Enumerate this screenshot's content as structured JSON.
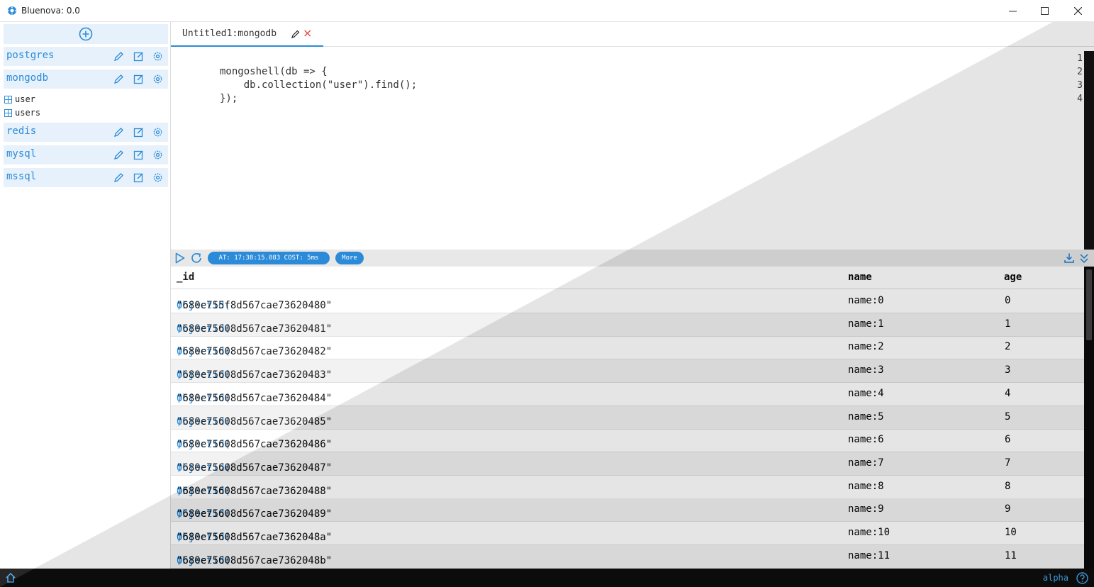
{
  "window": {
    "title": "Bluenova: 0.0"
  },
  "sidebar": {
    "connections": [
      {
        "name": "postgres"
      },
      {
        "name": "mongodb"
      },
      {
        "name": "redis"
      },
      {
        "name": "mysql"
      },
      {
        "name": "mssql"
      }
    ],
    "tree": [
      {
        "label": "user"
      },
      {
        "label": "users"
      }
    ]
  },
  "tabs": [
    {
      "label": "Untitled1:mongodb"
    }
  ],
  "editor": {
    "line_numbers": [
      "1",
      "2",
      "3",
      "4"
    ],
    "lines": [
      "",
      "mongoshell(db => {",
      "    db.collection(\"user\").find();",
      "});"
    ]
  },
  "results_toolbar": {
    "status": "AT: 17:38:15.083 COST: 5ms",
    "more_label": "More"
  },
  "results": {
    "columns": [
      "_id",
      "name",
      "age"
    ],
    "rows": [
      {
        "oid": "ObjectId(",
        "value": "\"680e755f8d567cae73620480\"",
        "close": ")",
        "name": "name:0",
        "age": "0"
      },
      {
        "oid": "ObjectId(",
        "value": "\"680e75608d567cae73620481\"",
        "close": ")",
        "name": "name:1",
        "age": "1"
      },
      {
        "oid": "ObjectId(",
        "value": "\"680e75608d567cae73620482\"",
        "close": ")",
        "name": "name:2",
        "age": "2"
      },
      {
        "oid": "ObjectId(",
        "value": "\"680e75608d567cae73620483\"",
        "close": ")",
        "name": "name:3",
        "age": "3"
      },
      {
        "oid": "ObjectId(",
        "value": "\"680e75608d567cae73620484\"",
        "close": ")",
        "name": "name:4",
        "age": "4"
      },
      {
        "oid": "ObjectId(",
        "value": "\"680e75608d567cae73620485\"",
        "close": ")",
        "name": "name:5",
        "age": "5"
      },
      {
        "oid": "ObjectId(",
        "value": "\"680e75608d567cae73620486\"",
        "close": ")",
        "name": "name:6",
        "age": "6"
      },
      {
        "oid": "ObjectId(",
        "value": "\"680e75608d567cae73620487\"",
        "close": ")",
        "name": "name:7",
        "age": "7"
      },
      {
        "oid": "ObjectId(",
        "value": "\"680e75608d567cae73620488\"",
        "close": ")",
        "name": "name:8",
        "age": "8"
      },
      {
        "oid": "ObjectId(",
        "value": "\"680e75608d567cae73620489\"",
        "close": ")",
        "name": "name:9",
        "age": "9"
      },
      {
        "oid": "ObjectId(",
        "value": "\"680e75608d567cae7362048a\"",
        "close": ")",
        "name": "name:10",
        "age": "10"
      },
      {
        "oid": "ObjectId(",
        "value": "\"680e75608d567cae7362048b\"",
        "close": ")",
        "name": "name:11",
        "age": "11"
      }
    ]
  },
  "statusbar": {
    "label": "alpha"
  },
  "colors": {
    "accent": "#2c8bd8",
    "dark_theme": "#1e1e1e",
    "danger": "#e0443c"
  }
}
